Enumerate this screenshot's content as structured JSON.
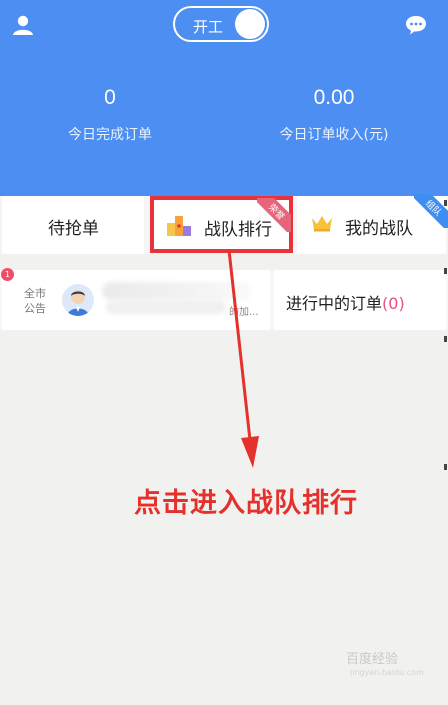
{
  "header": {
    "toggle_label": "开工",
    "stats": [
      {
        "value": "0",
        "label": "今日完成订单"
      },
      {
        "value": "0.00",
        "label": "今日订单收入(元)"
      }
    ]
  },
  "tabs": [
    {
      "label": "待抢单"
    },
    {
      "label": "战队排行",
      "ribbon": "荣誉"
    },
    {
      "label": "我的战队",
      "ribbon": "组队"
    }
  ],
  "notice": {
    "badge": "1",
    "tag": "全市公告",
    "snippet": "的加...",
    "ongoing_label": "进行中的订单",
    "ongoing_count": "(0)"
  },
  "annotation": "点击进入战队排行",
  "watermark": {
    "text": "百度经验",
    "sub": "jingyan.baidu.com"
  },
  "colors": {
    "primary": "#4c8ef2",
    "highlight": "#e8333b"
  }
}
